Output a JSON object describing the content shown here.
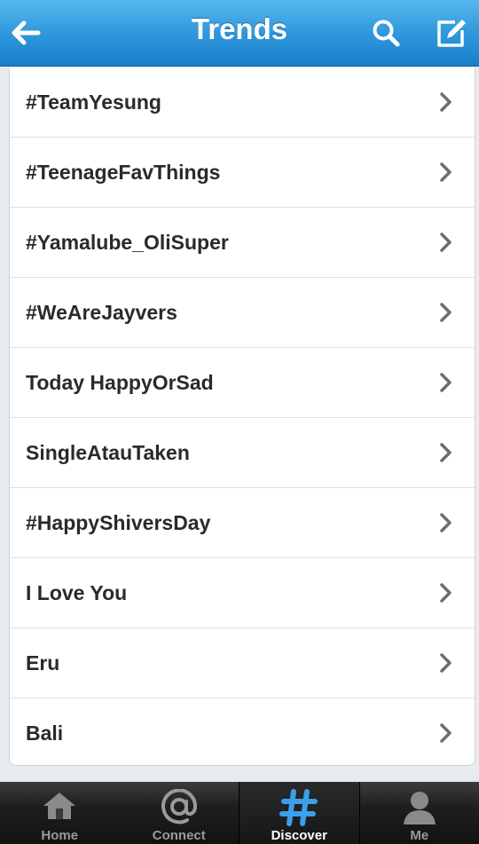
{
  "header": {
    "title": "Trends"
  },
  "trends": [
    {
      "label": "#TeamYesung"
    },
    {
      "label": "#TeenageFavThings"
    },
    {
      "label": "#Yamalube_OliSuper"
    },
    {
      "label": "#WeAreJayvers"
    },
    {
      "label": "Today HappyOrSad"
    },
    {
      "label": "SingleAtauTaken"
    },
    {
      "label": "#HappyShiversDay"
    },
    {
      "label": "I Love You"
    },
    {
      "label": "Eru"
    },
    {
      "label": "Bali"
    }
  ],
  "tabs": [
    {
      "label": "Home",
      "icon": "home-icon"
    },
    {
      "label": "Connect",
      "icon": "at-icon"
    },
    {
      "label": "Discover",
      "icon": "hash-icon",
      "active": true
    },
    {
      "label": "Me",
      "icon": "person-icon"
    }
  ],
  "colors": {
    "header": "#2f98dc",
    "active_tab_icon": "#3aa0ea"
  }
}
